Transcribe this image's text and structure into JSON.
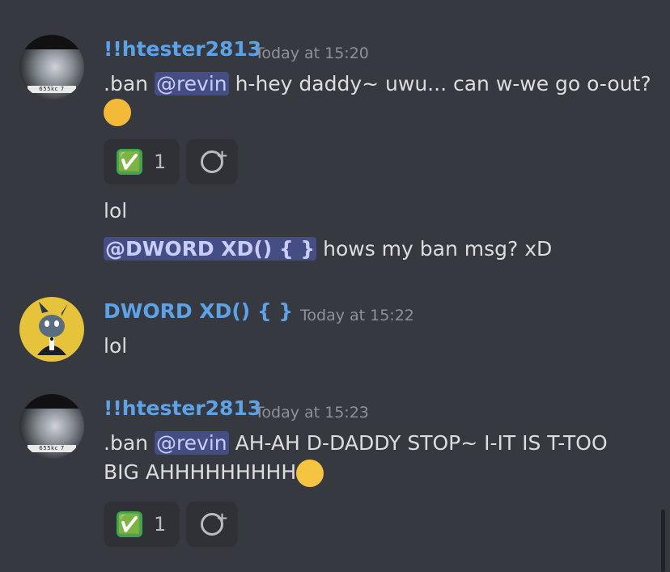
{
  "messages": [
    {
      "author": "!!htester2813",
      "time": "Today at 15:20",
      "avatar_text": "655kc 7",
      "lines": [
        {
          "prefix": ".ban ",
          "mention": "@revin",
          "text": " h-hey daddy~ uwu... can w-we go o-out?"
        }
      ],
      "emoji": "smiling-face-with-hearts-icon",
      "reaction": {
        "emoji": "✅",
        "count": "1"
      }
    },
    {
      "lines_extra": [
        {
          "text": "lol"
        },
        {
          "mention": "@DWORD XD() { }",
          "text": " hows my ban msg? xD"
        }
      ]
    },
    {
      "author": "DWORD XD() { }",
      "time": "Today at 15:22",
      "lines": [
        {
          "text": "lol"
        }
      ]
    },
    {
      "author": "!!htester2813",
      "time": "Today at 15:23",
      "avatar_text": "655kc 7",
      "lines": [
        {
          "prefix": ".ban ",
          "mention": "@revin",
          "text": " AH-AH D-DADDY STOP~ I-IT IS T-TOO"
        },
        {
          "text": "BIG AHHHHHHHHH"
        }
      ],
      "emoji": "drooling-face-icon",
      "reaction": {
        "emoji": "✅",
        "count": "1"
      }
    }
  ],
  "colors": {
    "background": "#36393f",
    "username": "#5da2e6",
    "mention_bg": "#444d84"
  }
}
